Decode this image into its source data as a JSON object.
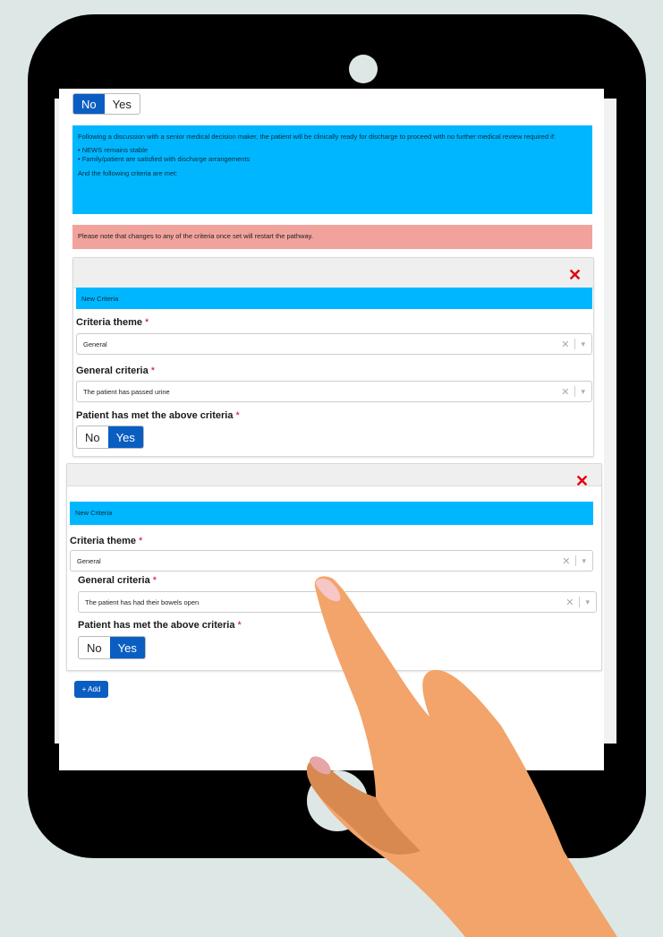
{
  "top_toggle": {
    "options": [
      "No",
      "Yes"
    ],
    "selected": "No"
  },
  "info_box": {
    "intro": "Following a discussion with a senior medical decision maker, the patient will be clinically ready for discharge to proceed with no further medical review required if:",
    "bullets": [
      "• NEWS remains stable",
      "• Family/patient are satisfied with discharge arrangements"
    ],
    "outro": "And the following criteria are met:"
  },
  "warning": "Please note that changes to any of the criteria once set will restart the pathway.",
  "criteria": [
    {
      "header": "New Criteria",
      "theme_label": "Criteria theme",
      "theme_value": "General",
      "criteria_label": "General criteria",
      "criteria_value": "The patient has passed urine",
      "met_label": "Patient has met the above criteria",
      "met_options": [
        "No",
        "Yes"
      ],
      "met_selected": "Yes"
    },
    {
      "header": "New Criteria",
      "theme_label": "Criteria theme",
      "theme_value": "General",
      "criteria_label": "General criteria",
      "criteria_value": "The patient has had their bowels open",
      "met_label": "Patient has met the above criteria",
      "met_options": [
        "No",
        "Yes"
      ],
      "met_selected": "Yes"
    }
  ],
  "required_mark": "*",
  "add_button": {
    "icon": "plus-icon",
    "label": "+ Add"
  },
  "colors": {
    "accent": "#0a5ec2",
    "info": "#00b7ff",
    "warning": "#f2a29c",
    "remove": "#e3000b"
  }
}
